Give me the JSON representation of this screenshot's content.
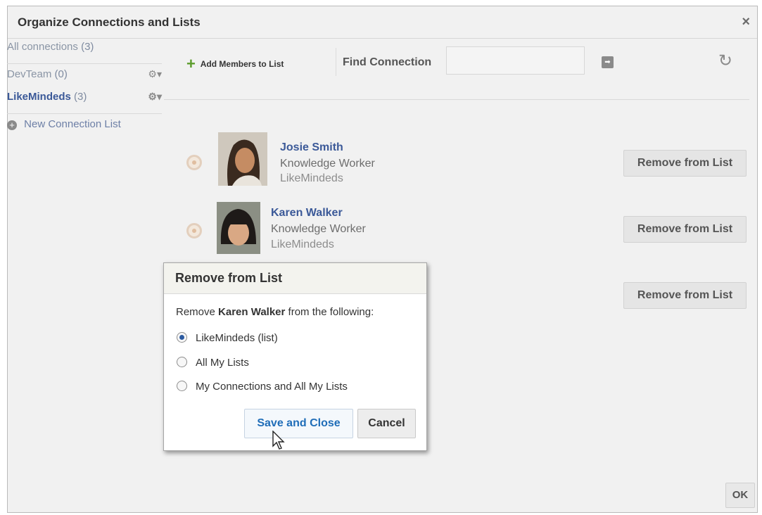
{
  "dialog": {
    "title": "Organize Connections and Lists",
    "close_label": "×",
    "ok_label": "OK"
  },
  "sidebar": {
    "items": [
      {
        "label": "All connections",
        "count": "(3)"
      },
      {
        "label": "DevTeam",
        "count": "(0)"
      },
      {
        "label": "LikeMindeds",
        "count": "(3)"
      }
    ],
    "new_list_label": "New Connection List",
    "gear_glyph": "⚙▾"
  },
  "toolbar": {
    "add_members_label": "Add Members to List",
    "find_label": "Find Connection",
    "find_value": "",
    "go_glyph": "➡",
    "refresh_glyph": "↻"
  },
  "members": [
    {
      "name": "Josie Smith",
      "role": "Knowledge Worker",
      "list": "LikeMindeds",
      "action_label": "Remove from List"
    },
    {
      "name": "Karen Walker",
      "role": "Knowledge Worker",
      "list": "LikeMindeds",
      "action_label": "Remove from List"
    },
    {
      "action_label": "Remove from List"
    }
  ],
  "popup": {
    "title": "Remove from List",
    "text_prefix": "Remove",
    "text_name": "Karen Walker",
    "text_suffix": "from the following:",
    "options": [
      {
        "label": "LikeMindeds (list)",
        "selected": true
      },
      {
        "label": "All My Lists",
        "selected": false
      },
      {
        "label": "My Connections and All My Lists",
        "selected": false
      }
    ],
    "save_label": "Save and Close",
    "cancel_label": "Cancel"
  },
  "colors": {
    "link": "#3b5998",
    "primary_button_text": "#1f6db8",
    "add_icon": "#5c9c2c"
  }
}
